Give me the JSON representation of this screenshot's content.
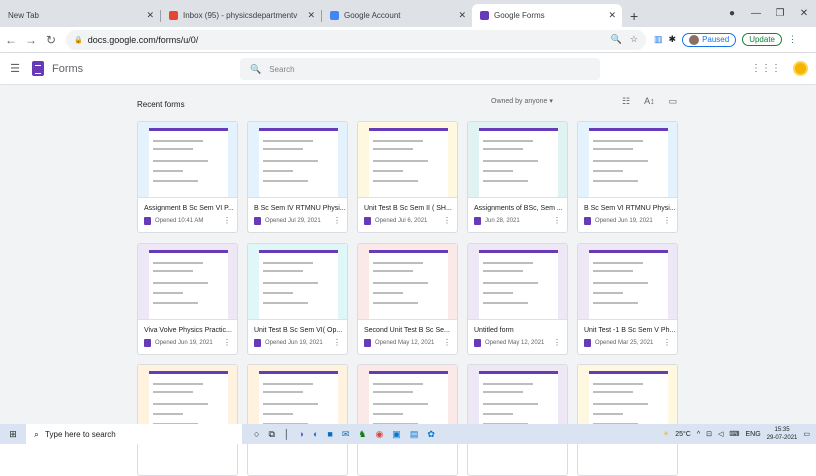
{
  "browser": {
    "tabs": [
      {
        "label": "New Tab",
        "active": false
      },
      {
        "label": "Inbox (95) - physicsdepartmentv",
        "active": false
      },
      {
        "label": "Google Account",
        "active": false
      },
      {
        "label": "Google Forms",
        "active": true
      }
    ],
    "url": "docs.google.com/forms/u/0/",
    "profile_label": "Paused",
    "update_label": "Update"
  },
  "app": {
    "title": "Forms",
    "search_placeholder": "Search"
  },
  "list": {
    "heading": "Recent forms",
    "owner_filter": "Owned by anyone"
  },
  "forms": [
    {
      "title": "Assignment B Sc Sem VI P...",
      "meta": "Opened 10:41 AM",
      "tint": "#e3f2fd"
    },
    {
      "title": "B Sc Sem IV RTMNU Physi...",
      "meta": "Opened Jul 29, 2021",
      "tint": "#e3f2fd"
    },
    {
      "title": "Unit Test B Sc Sem II ( SH...",
      "meta": "Opened Jul 6, 2021",
      "tint": "#fff8e1"
    },
    {
      "title": "Assignments of BSc, Sem ...",
      "meta": "Jun 28, 2021",
      "tint": "#e0f2f1"
    },
    {
      "title": "B Sc Sem VI RTMNU Physi...",
      "meta": "Opened Jun 19, 2021",
      "tint": "#e3f2fd"
    },
    {
      "title": "Viva Volve Physics Practic...",
      "meta": "Opened Jun 19, 2021",
      "tint": "#ede7f6"
    },
    {
      "title": "Unit Test B Sc Sem VI( Op...",
      "meta": "Opened Jun 19, 2021",
      "tint": "#e0f7fa"
    },
    {
      "title": "Second Unit Test B Sc Se...",
      "meta": "Opened May 12, 2021",
      "tint": "#fbe9e7"
    },
    {
      "title": "Untitled form",
      "meta": "Opened May 12, 2021",
      "tint": "#ede7f6"
    },
    {
      "title": "Unit Test -1 B Sc Sem V Ph...",
      "meta": "Opened Mar 25, 2021",
      "tint": "#ede7f6"
    },
    {
      "title": "",
      "meta": "",
      "tint": "#fff3e0"
    },
    {
      "title": "",
      "meta": "",
      "tint": "#fff3e0"
    },
    {
      "title": "",
      "meta": "",
      "tint": "#fbe9e7"
    },
    {
      "title": "",
      "meta": "",
      "tint": "#ede7f6"
    },
    {
      "title": "",
      "meta": "",
      "tint": "#fff8e1"
    }
  ],
  "taskbar": {
    "search_placeholder": "Type here to search",
    "weather": "25°C",
    "lang": "ENG",
    "time": "15:35",
    "date": "29-07-2021"
  },
  "colors": {
    "accent": "#673ab7",
    "link": "#1a73e8"
  }
}
